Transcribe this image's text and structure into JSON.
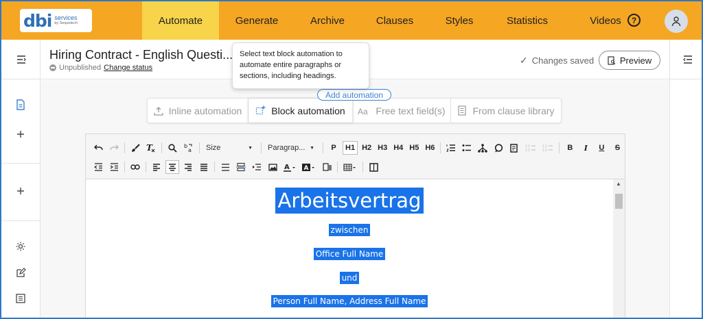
{
  "logo": {
    "main": "dbi",
    "sub1": "services",
    "sub2": "by Sequotech"
  },
  "nav": {
    "items": [
      "Automate",
      "Generate",
      "Archive",
      "Clauses",
      "Styles",
      "Statistics",
      "Videos"
    ],
    "active": "Automate",
    "help_glyph": "?"
  },
  "document": {
    "title": "Hiring Contract - English Questi...",
    "status": "Unpublished",
    "change_status": "Change status",
    "changes_saved": "Changes saved",
    "preview": "Preview"
  },
  "tooltip": {
    "text": "Select text block automation to automate entire paragraphs or sections, including headings."
  },
  "add_automation": "Add automation",
  "automation_tabs": [
    {
      "label": "Inline automation",
      "icon": "inline-automation-icon"
    },
    {
      "label": "Block automation",
      "icon": "block-automation-icon",
      "active": true
    },
    {
      "label": "Free text field(s)",
      "icon": "free-text-icon"
    },
    {
      "label": "From clause library",
      "icon": "clause-library-icon"
    }
  ],
  "toolbar": {
    "size_label": "Size",
    "paragraph_label": "Paragrap...",
    "p": "P",
    "h1": "H1",
    "h2": "H2",
    "h3": "H3",
    "h4": "H4",
    "h5": "H5",
    "h6": "H6",
    "bold": "B",
    "italic": "I",
    "underline": "U",
    "strike": "S"
  },
  "content": {
    "heading": "Arbeitsvertrag",
    "line1": "zwischen",
    "line2": "Office Full Name",
    "line3": "und",
    "line4": "Person Full Name, Address Full Name"
  },
  "colors": {
    "nav_bg": "#f5a623",
    "nav_active": "#f7d44a",
    "selection": "#1a73e8",
    "brand_blue": "#2f6fb5"
  }
}
